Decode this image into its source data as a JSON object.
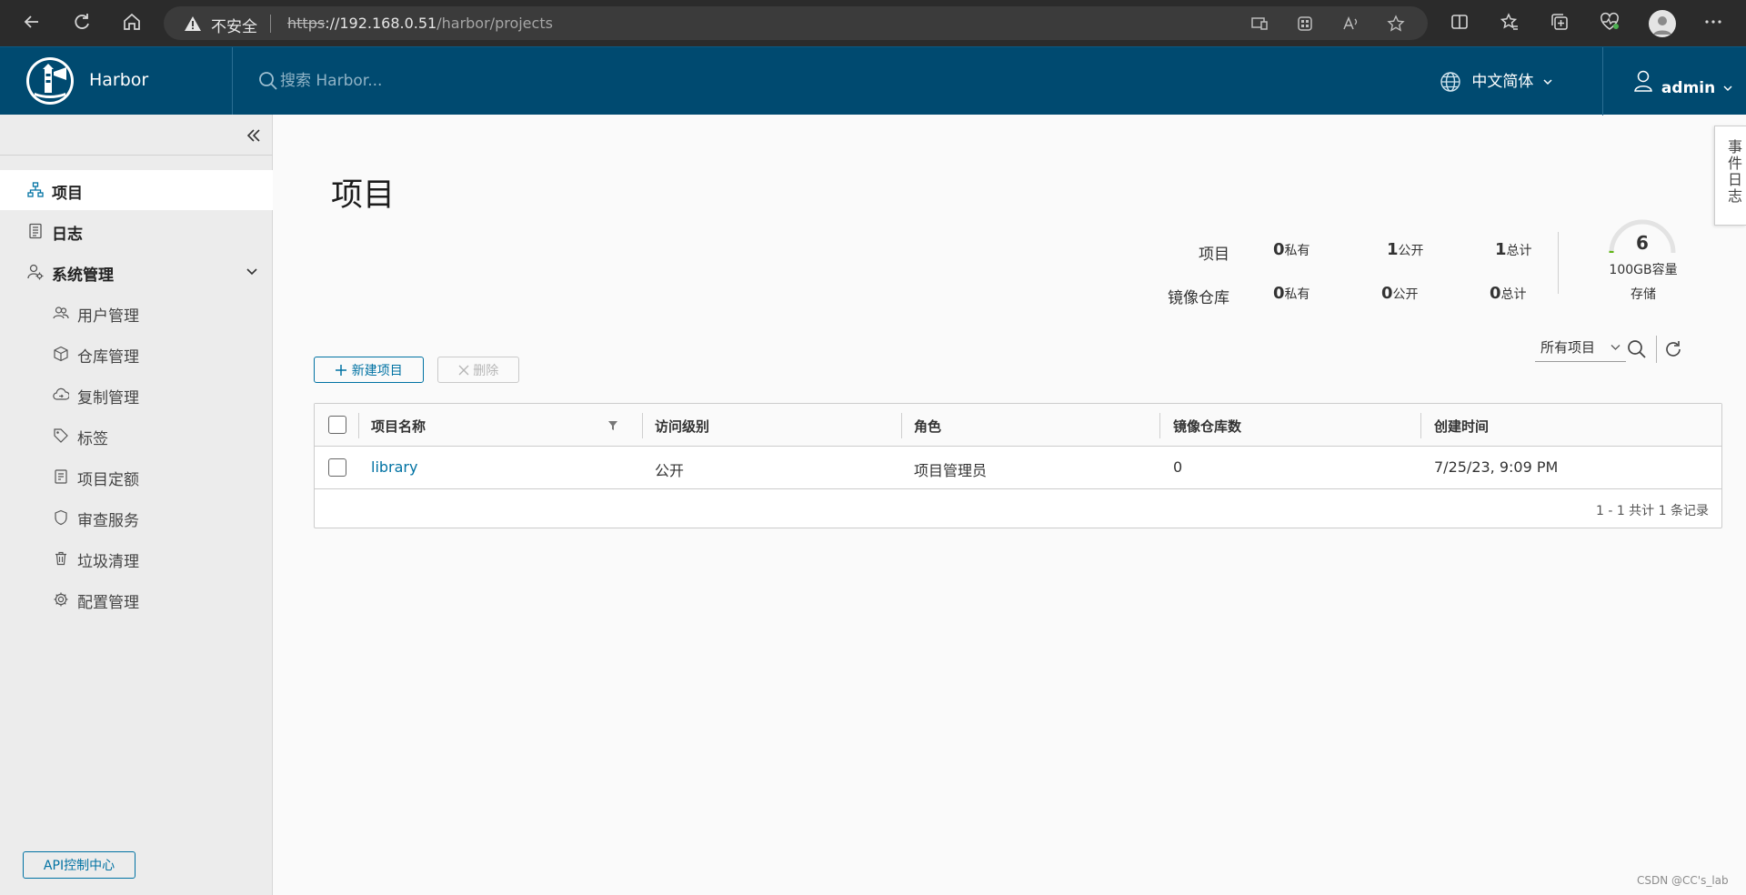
{
  "browser": {
    "security_text": "不安全",
    "url_scheme": "https",
    "url_host": "://192.168.0.51",
    "url_path": "/harbor/projects"
  },
  "header": {
    "brand": "Harbor",
    "search_placeholder": "搜索 Harbor...",
    "language": "中文简体",
    "user": "admin"
  },
  "sidebar": {
    "items": [
      {
        "label": "项目",
        "icon": "projects-icon"
      },
      {
        "label": "日志",
        "icon": "logs-icon"
      },
      {
        "label": "系统管理",
        "icon": "admin-icon"
      }
    ],
    "sub_items": [
      {
        "label": "用户管理",
        "icon": "users-icon"
      },
      {
        "label": "仓库管理",
        "icon": "registry-icon"
      },
      {
        "label": "复制管理",
        "icon": "replication-icon"
      },
      {
        "label": "标签",
        "icon": "tag-icon"
      },
      {
        "label": "项目定额",
        "icon": "quota-icon"
      },
      {
        "label": "审查服务",
        "icon": "shield-icon"
      },
      {
        "label": "垃圾清理",
        "icon": "trash-icon"
      },
      {
        "label": "配置管理",
        "icon": "gear-icon"
      }
    ],
    "api_button": "API控制中心"
  },
  "main": {
    "title": "项目",
    "event_log_tab": "事件日志",
    "stats": {
      "projects_label": "项目",
      "repos_label": "镜像仓库",
      "projects": [
        {
          "num": "0",
          "unit": "私有"
        },
        {
          "num": "1",
          "unit": "公开"
        },
        {
          "num": "1",
          "unit": "总计"
        }
      ],
      "repos": [
        {
          "num": "0",
          "unit": "私有"
        },
        {
          "num": "0",
          "unit": "公开"
        },
        {
          "num": "0",
          "unit": "总计"
        }
      ],
      "quota_count": "6",
      "quota_capacity": "100GB容量",
      "quota_label": "存储",
      "quota_used_fraction": 0.02
    },
    "toolbar": {
      "new_project": "新建项目",
      "delete": "删除",
      "filter_value": "所有项目"
    },
    "table": {
      "columns": [
        "项目名称",
        "访问级别",
        "角色",
        "镜像仓库数",
        "创建时间"
      ],
      "rows": [
        {
          "name": "library",
          "access": "公开",
          "role": "项目管理员",
          "repo_count": "0",
          "created": "7/25/23, 9:09 PM"
        }
      ],
      "footer": "1 - 1 共计 1 条记录"
    }
  },
  "watermark": "CSDN @CC's_lab",
  "colors": {
    "header_bg": "#004a70",
    "accent": "#0072a3",
    "sidebar_bg": "#ececec"
  }
}
